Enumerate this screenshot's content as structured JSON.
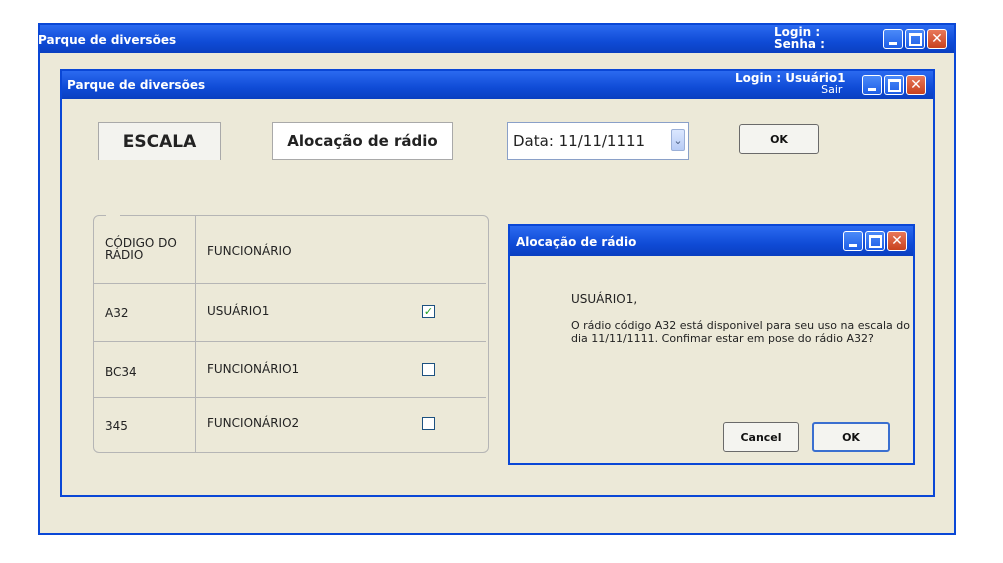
{
  "outer_window": {
    "title": "Parque de diversões",
    "login_label": "Login :",
    "senha_label": "Senha :"
  },
  "inner_window": {
    "title": "Parque de diversões",
    "login_text": "Login : Usuário1",
    "logout_link": "Sair"
  },
  "tabs": {
    "escala": "ESCALA",
    "alocacao": "Alocação de rádio"
  },
  "date_select": {
    "value": "Data: 11/11/1111"
  },
  "ok_button": "OK",
  "table": {
    "headers": [
      "CÓDIGO DO RÁDIO",
      "FUNCIONÁRIO"
    ],
    "rows": [
      {
        "code": "A32",
        "employee": "USUÁRIO1",
        "checked": true
      },
      {
        "code": "BC34",
        "employee": "FUNCIONÁRIO1",
        "checked": false
      },
      {
        "code": "345",
        "employee": "FUNCIONÁRIO2",
        "checked": false
      }
    ]
  },
  "dialog": {
    "title": "Alocação de rádio",
    "greeting": "USUÁRIO1,",
    "message": "O rádio código A32 está disponivel para seu uso na escala do dia 11/11/1111. Confimar estar em pose do rádio A32?",
    "cancel_label": "Cancel",
    "ok_label": "OK"
  },
  "colors": {
    "titlebar": "#1b57e0",
    "window_bg": "#ece9d8",
    "close_button": "#d9542c",
    "checkmark": "#21a121"
  }
}
